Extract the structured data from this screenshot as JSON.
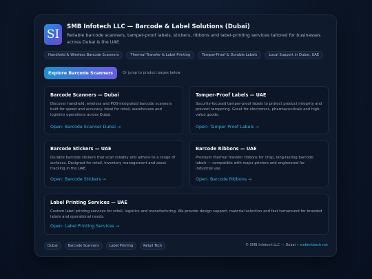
{
  "header": {
    "logo_text": "SI",
    "title": "SMB Infotech LLC — Barcode & Label Solutions (Dubai)",
    "subtitle": "Reliable barcode scanners, tamper-proof labels, stickers, ribbons and label-printing services tailored for businesses across Dubai & the UAE.",
    "tags": [
      "Handheld & Wireless Barcode Scanners",
      "Thermal Transfer & Label Printing",
      "Tamper-Proof & Durable Labels",
      "Local Support in Dubai, UAE"
    ]
  },
  "cta": {
    "button_label": "Explore Barcode Scanners",
    "note": "Or jump to product pages below"
  },
  "products": [
    {
      "title": "Barcode Scanners — Dubai",
      "description": "Discover handheld, wireless and POS-integrated barcode scanners built for speed and accuracy. Ideal for retail, warehouses and logistics operations across Dubai.",
      "link": "Open: Barcode Scanner Dubai →"
    },
    {
      "title": "Tamper-Proof Labels — UAE",
      "description": "Security-focused tamper-proof labels to protect product integrity and prevent tampering. Great for electronics, pharmaceuticals and high-value goods.",
      "link": "Open: Tamper Proof Labels →"
    },
    {
      "title": "Barcode Stickers — UAE",
      "description": "Durable barcode stickers that scan reliably and adhere to a range of surfaces. Designed for retail, inventory management and asset tracking in the UAE.",
      "link": "Open: Barcode Stickers →"
    },
    {
      "title": "Barcode Ribbons — UAE",
      "description": "Premium thermal transfer ribbons for crisp, long-lasting barcode labels — compatible with major printers and engineered for industrial use.",
      "link": "Open: Barcode Ribbons →"
    },
    {
      "title": "Label Printing Services — UAE",
      "description": "Custom label printing services for retail, logistics and manufacturing. We provide design support, material selection and fast turnaround for branded labels and operational needs.",
      "link": "Open: Label Printing Services →"
    }
  ],
  "footer": {
    "tags": [
      "Dubai",
      "Barcode Scanners",
      "Label Printing",
      "Retail Tech"
    ],
    "copyright": "© SMB Infotech LLC — Dubai •",
    "site_link": "smbinfotech.net"
  }
}
